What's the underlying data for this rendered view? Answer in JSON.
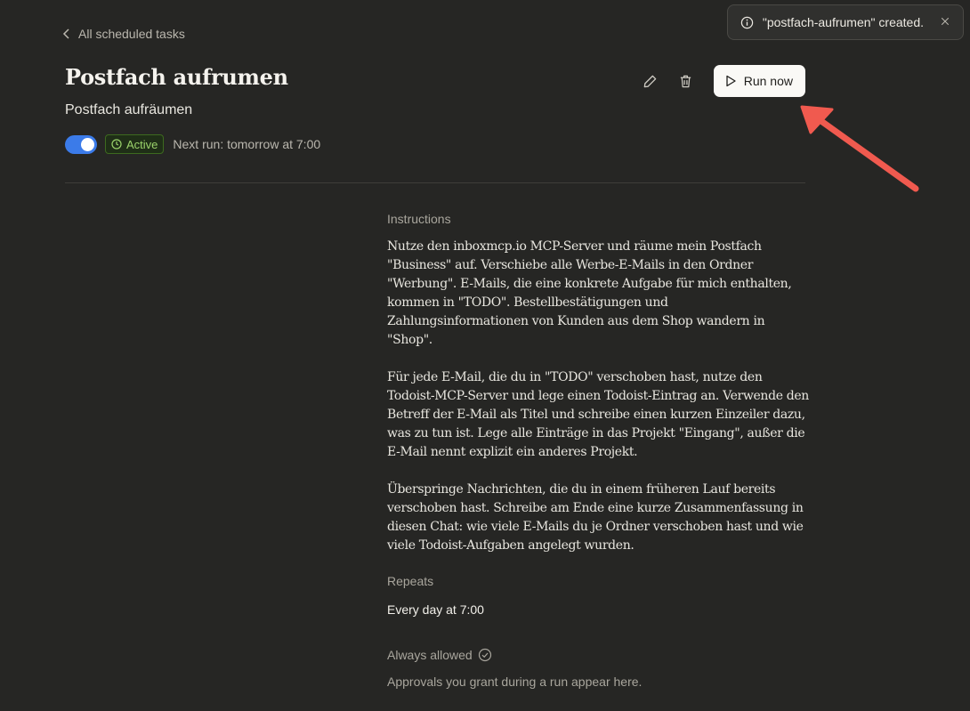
{
  "back_link": {
    "label": "All scheduled tasks",
    "icon": "chevron-left-icon"
  },
  "task": {
    "title": "Postfach aufrumen",
    "subtitle": "Postfach aufräumen",
    "toggle_enabled": true,
    "status_badge": "Active",
    "next_run": "Next run: tomorrow at 7:00"
  },
  "actions": {
    "edit_icon": "pencil-icon",
    "delete_icon": "trash-icon",
    "run_label": "Run now"
  },
  "toast": {
    "message": "\"postfach-aufrumen\" created.",
    "icon": "info-icon",
    "close_icon": "close-icon"
  },
  "sections": {
    "instructions_label": "Instructions",
    "instructions": [
      "Nutze den inboxmcp.io MCP-Server und räume mein Postfach \"Business\" auf. Verschiebe alle Werbe-E-Mails in den Ordner \"Werbung\". E-Mails, die eine konkrete Aufgabe für mich enthalten, kommen in \"TODO\". Bestellbestätigungen und Zahlungsinformationen von Kunden aus dem Shop wandern in \"Shop\".",
      "Für jede E-Mail, die du in \"TODO\" verschoben hast, nutze den Todoist-MCP-Server und lege einen Todoist-Eintrag an. Verwende den Betreff der E-Mail als Titel und schreibe einen kurzen Einzeiler dazu, was zu tun ist. Lege alle Einträge in das Projekt \"Eingang\", außer die E-Mail nennt explizit ein anderes Projekt.",
      "Überspringe Nachrichten, die du in einem früheren Lauf bereits verschoben hast. Schreibe am Ende eine kurze Zusammenfassung in diesen Chat: wie viele E-Mails du je Ordner verschoben hast und wie viele Todoist-Aufgaben angelegt wurden."
    ],
    "repeats_label": "Repeats",
    "repeats_value": "Every day at 7:00",
    "allowed_label": "Always allowed",
    "approvals_text": "Approvals you grant during a run appear here."
  },
  "colors": {
    "accent_toggle": "#3b7be9",
    "active_badge": "#9bd36b",
    "annotation_arrow": "#f05a4f",
    "background": "#262624"
  }
}
